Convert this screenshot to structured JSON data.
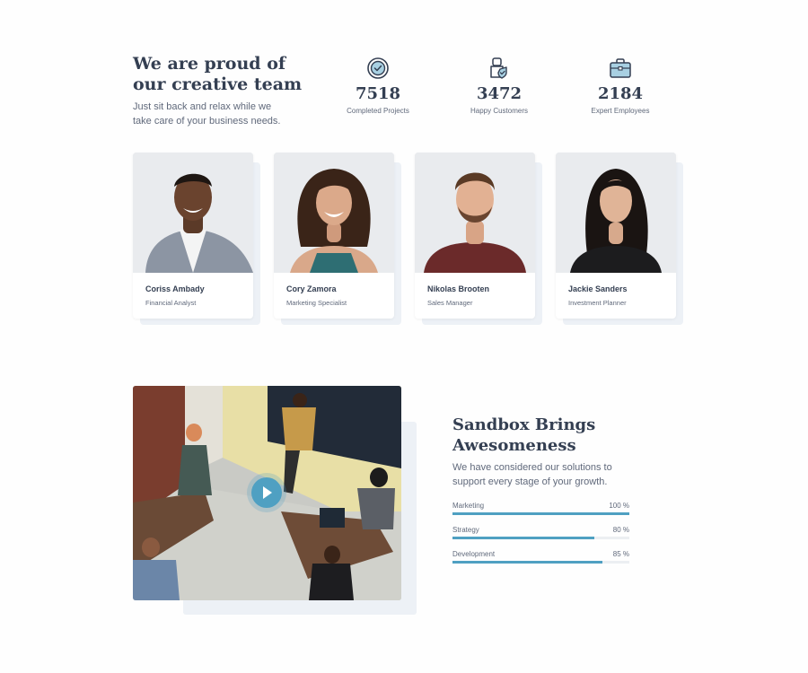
{
  "hero": {
    "title": "We are proud of our creative team",
    "subtitle": "Just sit back and relax while we take care of your business needs."
  },
  "stats": [
    {
      "icon": "clock-icon",
      "value": "7518",
      "label": "Completed Projects"
    },
    {
      "icon": "shield-check-icon",
      "value": "3472",
      "label": "Happy Customers"
    },
    {
      "icon": "briefcase-icon",
      "value": "2184",
      "label": "Expert Employees"
    }
  ],
  "team": [
    {
      "name": "Coriss Ambady",
      "role": "Financial Analyst"
    },
    {
      "name": "Cory Zamora",
      "role": "Marketing Specialist"
    },
    {
      "name": "Nikolas Brooten",
      "role": "Sales Manager"
    },
    {
      "name": "Jackie Sanders",
      "role": "Investment Planner"
    }
  ],
  "feature": {
    "title": "Sandbox Brings Awesomeness",
    "text": "We have considered our solutions to support every stage of your growth.",
    "skills": [
      {
        "label": "Marketing",
        "percent_text": "100 %",
        "value": 100
      },
      {
        "label": "Strategy",
        "percent_text": "80 %",
        "value": 80
      },
      {
        "label": "Development",
        "percent_text": "85 %",
        "value": 85
      }
    ]
  },
  "colors": {
    "accent": "#4fa0c2",
    "heading": "#343f52",
    "text": "#60697b",
    "soft_bg": "#edf1f6"
  }
}
